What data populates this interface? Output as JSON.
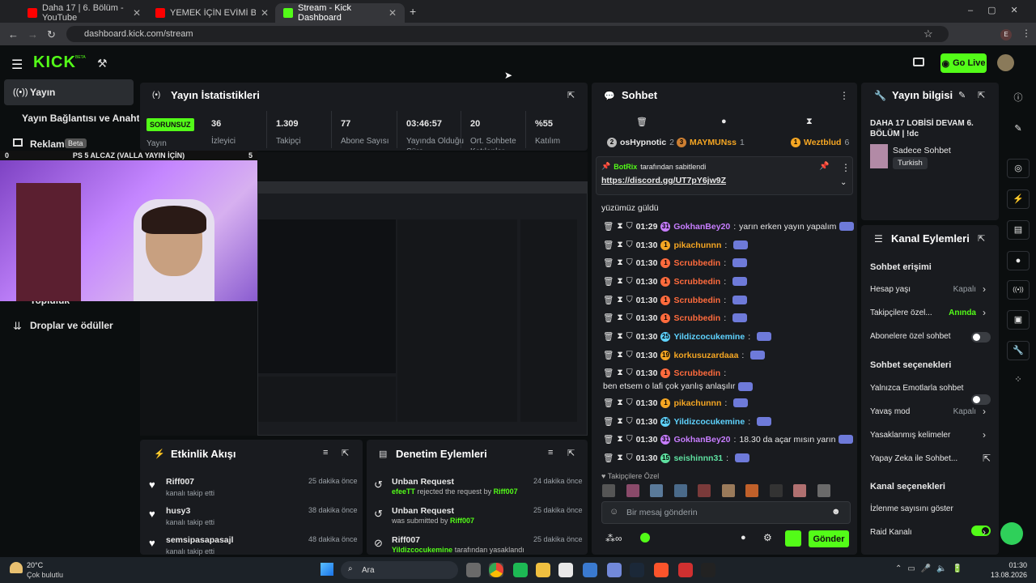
{
  "browser": {
    "tabs": [
      {
        "title": "Daha 17 | 6. Bölüm - YouTube"
      },
      {
        "title": "YEMEK İÇİN EVİMİ BASTILAR! E"
      },
      {
        "title": "Stream - Kick Dashboard"
      }
    ],
    "url": "dashboard.kick.com/stream"
  },
  "header": {
    "logo": "KICK",
    "beta": "BETA",
    "go_live": "Go Live"
  },
  "sidebar": {
    "items": [
      {
        "label": "Yayın"
      },
      {
        "label": "Yayın Bağlantısı ve Anahtarı"
      },
      {
        "label": "Reklam",
        "badge": "Beta"
      },
      {
        "label": "Topluluk"
      },
      {
        "label": "Droplar ve ödüller"
      }
    ]
  },
  "stats": {
    "title": "Yayın İstatistikleri",
    "status": "SORUNSUZ",
    "items": [
      {
        "value": "36",
        "label": "İzleyici"
      },
      {
        "value": "1.309",
        "label": "Takipçi"
      },
      {
        "value": "77",
        "label": "Abone Sayısı"
      },
      {
        "value": "03:46:57",
        "label": "Yayında Olduğu Süre"
      },
      {
        "value": "20",
        "label": "Ort. Sohbete Katılanlar"
      },
      {
        "value": "%55",
        "label": "Katılım"
      }
    ],
    "yayin_label": "Yayın"
  },
  "webcam": {
    "caption": "PS 5 ALCAZ (VALLA YAYIN İÇİN)",
    "left": "0",
    "right": "5"
  },
  "activity": {
    "title": "Etkinlik Akışı",
    "items": [
      {
        "user": "Riff007",
        "action": "kanalı takip etti",
        "time": "25 dakika önce"
      },
      {
        "user": "husy3",
        "action": "kanalı takip etti",
        "time": "38 dakika önce"
      },
      {
        "user": "semsipasapasajl",
        "action": "kanalı takip etti",
        "time": "48 dakika önce"
      }
    ]
  },
  "moderation": {
    "title": "Denetim Eylemleri",
    "items": [
      {
        "title": "Unban Request",
        "user1": "efeeTT",
        "text": "rejected the request by",
        "user2": "Riff007",
        "time": "24 dakika önce"
      },
      {
        "title": "Unban Request",
        "user1": "",
        "text": "was submitted by",
        "user2": "Riff007",
        "time": "25 dakika önce"
      },
      {
        "title": "Riff007",
        "user1": "Yildizcocukemine",
        "text": "tarafından yasaklandı",
        "user2": "",
        "time": "25 dakika önce"
      }
    ]
  },
  "chat": {
    "title": "Sohbet",
    "top_users": [
      {
        "name": "osHypnotic",
        "count": "2"
      },
      {
        "name": "MAYMUNss",
        "count": "1"
      },
      {
        "name": "Weztblud",
        "count": "6"
      }
    ],
    "pinned": {
      "user": "BotRix",
      "by": "tarafından sabitlendi",
      "link": "https://discord.gg/UT7pY6jw9Z"
    },
    "first_line": {
      "text": "yüzümüz güldü"
    },
    "messages": [
      {
        "time": "01:29",
        "badge": "31",
        "user": "GokhanBey20",
        "text": "yarın erken yayın yapalım",
        "color": "#c77dff"
      },
      {
        "time": "01:30",
        "badge": "1",
        "user": "pikachunnn",
        "text": "",
        "color": "#f5a623"
      },
      {
        "time": "01:30",
        "badge": "1",
        "user": "Scrubbedin",
        "text": "",
        "color": "#ff6b3d"
      },
      {
        "time": "01:30",
        "badge": "1",
        "user": "Scrubbedin",
        "text": "",
        "color": "#ff6b3d"
      },
      {
        "time": "01:30",
        "badge": "1",
        "user": "Scrubbedin",
        "text": "",
        "color": "#ff6b3d"
      },
      {
        "time": "01:30",
        "badge": "1",
        "user": "Scrubbedin",
        "text": "",
        "color": "#ff6b3d"
      },
      {
        "time": "01:30",
        "badge": "25",
        "user": "Yildizcocukemine",
        "text": "",
        "color": "#5fd3ff"
      },
      {
        "time": "01:30",
        "badge": "19",
        "user": "korkusuzardaaa",
        "text": "",
        "color": "#f5a623"
      },
      {
        "time": "01:30",
        "badge": "1",
        "user": "Scrubbedin",
        "text": "ben etsem o lafi çok yanlış anlaşılır",
        "color": "#ff6b3d"
      },
      {
        "time": "01:30",
        "badge": "1",
        "user": "pikachunnn",
        "text": "",
        "color": "#f5a623"
      },
      {
        "time": "01:30",
        "badge": "25",
        "user": "Yildizcocukemine",
        "text": "",
        "color": "#5fd3ff"
      },
      {
        "time": "01:30",
        "badge": "31",
        "user": "GokhanBey20",
        "text": "18.30 da açar mısın yarın",
        "color": "#c77dff"
      },
      {
        "time": "01:30",
        "badge": "15",
        "user": "seishinnn31",
        "text": "",
        "color": "#5ee0a0"
      }
    ],
    "followers_only": "Takipçilere Özel",
    "placeholder": "Bir mesaj gönderin",
    "send": "Gönder"
  },
  "stream_info": {
    "title": "Yayın bilgisi",
    "stream_title": "DAHA 17 LOBİSİ DEVAM 6. BÖLÜM | !dc",
    "category": "Sadece Sohbet",
    "language": "Turkish"
  },
  "channel_actions": {
    "title": "Kanal Eylemleri",
    "chat_access": "Sohbet erişimi",
    "rows1": [
      {
        "label": "Hesap yaşı",
        "value": "Kapalı"
      },
      {
        "label": "Takipçilere özel...",
        "value": "Anında"
      },
      {
        "label": "Abonelere özel sohbet",
        "value": ""
      }
    ],
    "chat_options": "Sohbet seçenekleri",
    "rows2": [
      {
        "label": "Yalnızca Emotlarla sohbet",
        "value": ""
      },
      {
        "label": "Yavaş mod",
        "value": "Kapalı"
      },
      {
        "label": "Yasaklanmış kelimeler",
        "value": ""
      },
      {
        "label": "Yapay Zeka ile Sohbet...",
        "value": ""
      }
    ],
    "channel_options": "Kanal seçenekleri",
    "rows3": [
      {
        "label": "İzlenme sayısını göster",
        "value": ""
      },
      {
        "label": "Raid Kanalı",
        "value": ""
      }
    ]
  },
  "taskbar": {
    "weather_temp": "20°C",
    "weather_text": "Çok bulutlu",
    "search": "Ara",
    "time": "01:30",
    "date": "13.08.2026"
  }
}
